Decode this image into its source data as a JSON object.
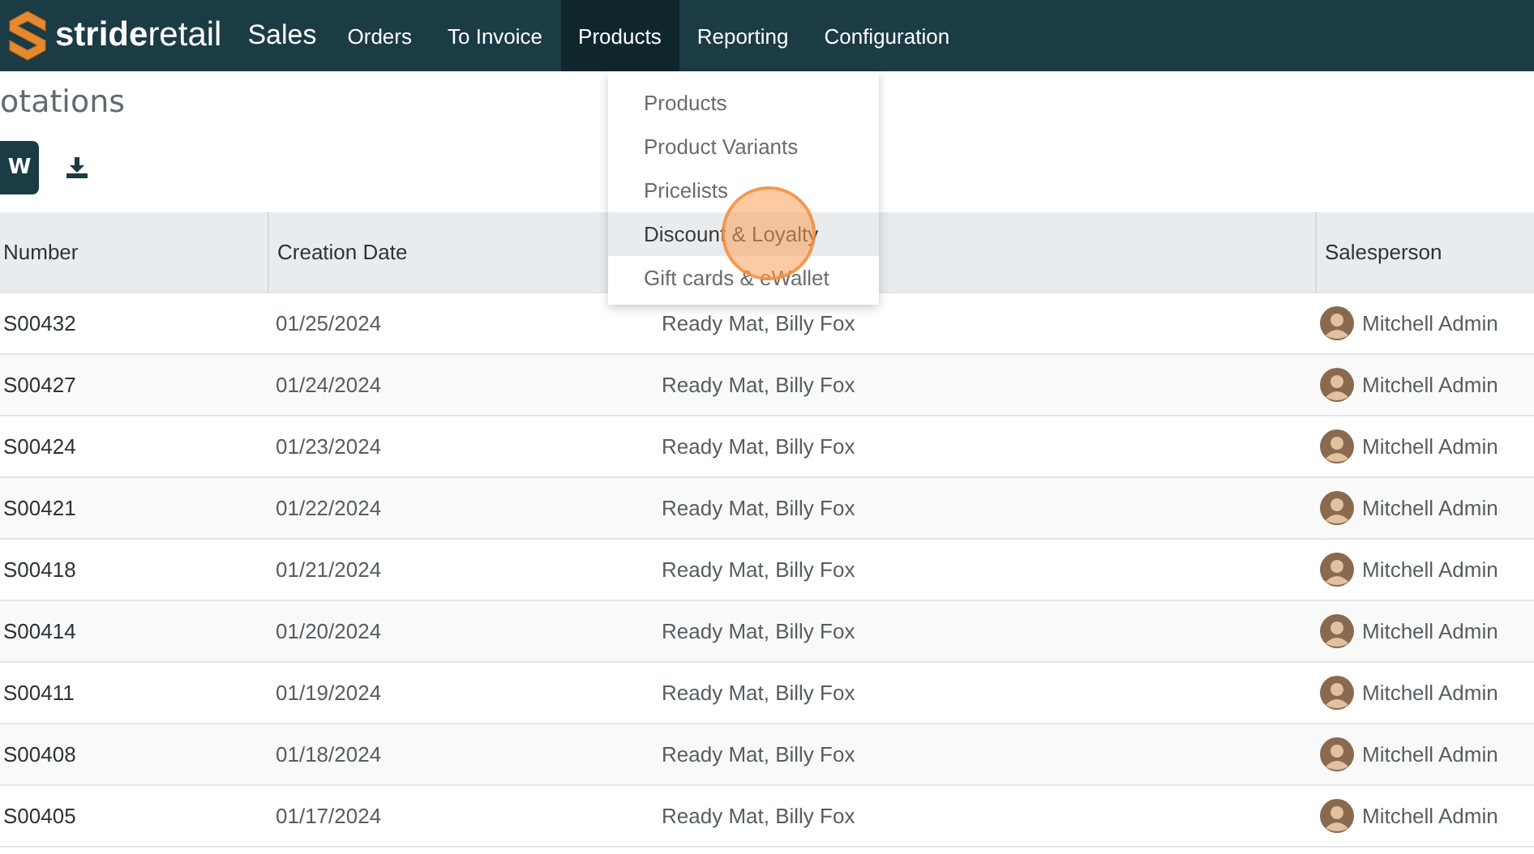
{
  "navbar": {
    "brand_bold": "stride",
    "brand_light": "retail",
    "app": "Sales",
    "menu": [
      {
        "label": "Orders",
        "selected": false
      },
      {
        "label": "To Invoice",
        "selected": false
      },
      {
        "label": "Products",
        "selected": true
      },
      {
        "label": "Reporting",
        "selected": false
      },
      {
        "label": "Configuration",
        "selected": false
      }
    ]
  },
  "dropdown": {
    "items": [
      {
        "label": "Products",
        "selected": false
      },
      {
        "label": "Product Variants",
        "selected": false
      },
      {
        "label": "Pricelists",
        "selected": false
      },
      {
        "label": "Discount & Loyalty",
        "selected": true
      },
      {
        "label": "Gift cards & eWallet",
        "selected": false
      }
    ]
  },
  "page": {
    "title": "otations",
    "new_button": "W"
  },
  "table": {
    "columns": [
      "Number",
      "Creation Date",
      "Salesperson"
    ],
    "rows": [
      {
        "number": "S00432",
        "date": "01/25/2024",
        "customer": "Ready Mat, Billy Fox",
        "salesperson": "Mitchell Admin"
      },
      {
        "number": "S00427",
        "date": "01/24/2024",
        "customer": "Ready Mat, Billy Fox",
        "salesperson": "Mitchell Admin"
      },
      {
        "number": "S00424",
        "date": "01/23/2024",
        "customer": "Ready Mat, Billy Fox",
        "salesperson": "Mitchell Admin"
      },
      {
        "number": "S00421",
        "date": "01/22/2024",
        "customer": "Ready Mat, Billy Fox",
        "salesperson": "Mitchell Admin"
      },
      {
        "number": "S00418",
        "date": "01/21/2024",
        "customer": "Ready Mat, Billy Fox",
        "salesperson": "Mitchell Admin"
      },
      {
        "number": "S00414",
        "date": "01/20/2024",
        "customer": "Ready Mat, Billy Fox",
        "salesperson": "Mitchell Admin"
      },
      {
        "number": "S00411",
        "date": "01/19/2024",
        "customer": "Ready Mat, Billy Fox",
        "salesperson": "Mitchell Admin"
      },
      {
        "number": "S00408",
        "date": "01/18/2024",
        "customer": "Ready Mat, Billy Fox",
        "salesperson": "Mitchell Admin"
      },
      {
        "number": "S00405",
        "date": "01/17/2024",
        "customer": "Ready Mat, Billy Fox",
        "salesperson": "Mitchell Admin"
      }
    ]
  }
}
